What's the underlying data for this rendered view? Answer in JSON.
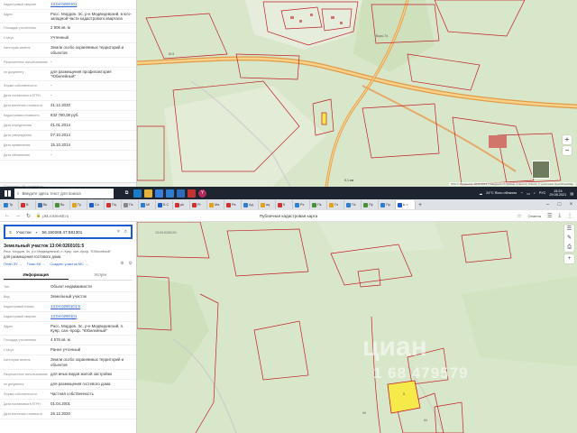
{
  "top_panel": {
    "rows": [
      {
        "key": "Кадастровый квартал",
        "value": "13:04:0260101",
        "link": true
      },
      {
        "key": "Адрес",
        "value": "Росс. Мордов. Эс, р-н Медведевский, в юго-западной части кадастрового квартала",
        "link": false
      },
      {
        "key": "Площадь уточненная",
        "value": "2 906 кв. м",
        "link": false
      },
      {
        "key": "Статус",
        "value": "Учтенный",
        "link": false
      },
      {
        "key": "Категория земель",
        "value": "Земли особо охраняемых территорий и объектов",
        "link": false
      },
      {
        "key": "Разрешенное использование",
        "value": "-",
        "link": false
      },
      {
        "key": "по документу",
        "value": "для размещения профилактория \"Юбилейный\"",
        "link": false
      },
      {
        "key": "Форма собственности",
        "value": "-",
        "link": false
      },
      {
        "key": "Дата постановки в ЕГРН",
        "value": "-",
        "link": false
      },
      {
        "key": "Дата внесения стоимости",
        "value": "31.12.2020",
        "link": false
      },
      {
        "key": "Кадастровая стоимость",
        "value": "832 780,08 руб.",
        "link": false
      },
      {
        "key": "Дата определения",
        "value": "01.01.2014",
        "link": false
      },
      {
        "key": "Дата утверждения",
        "value": "07.10.2014",
        "link": false
      },
      {
        "key": "Дата применения",
        "value": "15.10.2014",
        "link": false
      },
      {
        "key": "Дата обновления",
        "value": "-",
        "link": false
      }
    ],
    "footer": "Соединено pkk.rosreestr.ru"
  },
  "top_map": {
    "road_labels": [
      "М-5",
      "Ворк-74"
    ],
    "scale_label": "0,1 км",
    "attribution": "ПКК © Росреестр, 2010-2021 | Сведения об уровне точности, USGS | © участники OpenStreetMap"
  },
  "taskbar": {
    "search_placeholder": "Введите здесь текст для поиска",
    "weather": "24°C  Ясно облачно",
    "lang": "РУС",
    "time": "15:24",
    "date": "29.06.2021"
  },
  "tabs": [
    {
      "label": "Тр",
      "color": "#2d7dd2"
    },
    {
      "label": "В",
      "color": "#d23030"
    },
    {
      "label": "Вк",
      "color": "#3d6fb6"
    },
    {
      "label": "Вс",
      "color": "#4a8f3a"
    },
    {
      "label": "Гр",
      "color": "#e2a31c"
    },
    {
      "label": "Со",
      "color": "#1a5cd0"
    },
    {
      "label": "Пц",
      "color": "#d23030"
    },
    {
      "label": "Пс",
      "color": "#888888"
    },
    {
      "label": "Mi",
      "color": "#2d7dd2"
    },
    {
      "label": "Б С",
      "color": "#1a5cd0"
    },
    {
      "label": "pk",
      "color": "#d23030"
    },
    {
      "label": "Pr",
      "color": "#d23030"
    },
    {
      "label": "Ма",
      "color": "#e2a31c"
    },
    {
      "label": "Ра",
      "color": "#d23030"
    },
    {
      "label": "Ад",
      "color": "#2d7dd2"
    },
    {
      "label": "яц",
      "color": "#e2a31c"
    },
    {
      "label": "К",
      "color": "#d23030"
    },
    {
      "label": "Рэ",
      "color": "#2d7dd2"
    },
    {
      "label": "Пк",
      "color": "#4a8f3a"
    },
    {
      "label": "Гл",
      "color": "#e2a31c"
    },
    {
      "label": "Пс",
      "color": "#2d7dd2"
    },
    {
      "label": "Пу",
      "color": "#4a8f3a"
    },
    {
      "label": "Пр",
      "color": "#2d7dd2"
    }
  ],
  "active_tab": {
    "label": "Ь",
    "color": "#1a5cd0"
  },
  "toolbar": {
    "url": "pkk.rosreestr.ru",
    "page_title": "Публичная кадастровая карта",
    "right_label": "Отмена"
  },
  "search": {
    "category": "Участки",
    "query": "56.150265 47.581301"
  },
  "parcel": {
    "title": "Земельный участок 13:04:0260101:5",
    "address": "Росс. Мордов. Эс, р-н Медведевский, п. Куяр, сан.-проф. \"Юбилейный\"",
    "purpose": "для размещения гостевого дома",
    "links": [
      "План ЗУ →",
      "План КК →",
      "Создать участок МС →"
    ],
    "tab_info": "Информация",
    "tab_services": "Услуги",
    "rows": [
      {
        "key": "Тип",
        "value": "Объект недвижимости",
        "link": false
      },
      {
        "key": "Вид",
        "value": "Земельный участок",
        "link": false
      },
      {
        "key": "Кадастровый номер",
        "value": "13:04:0260101:5",
        "link": true
      },
      {
        "key": "Кадастровый квартал",
        "value": "13:04:0260101",
        "link": true
      },
      {
        "key": "Адрес",
        "value": "Росс. Мордов. Эс, р-н Медведевский, п. Куяр, сан.-проф. \"Юбилейный\"",
        "link": false
      },
      {
        "key": "Площадь уточненная",
        "value": "4 576 кв. м",
        "link": false
      },
      {
        "key": "Статус",
        "value": "Ранее учтенный",
        "link": false
      },
      {
        "key": "Категория земель",
        "value": "Земли особо охраняемых территорий и объектов",
        "link": false
      },
      {
        "key": "Разрешенное использование",
        "value": "для иных видов жилой застройки",
        "link": false
      },
      {
        "key": "по документу",
        "value": "для размещения гостевого дома",
        "link": false
      },
      {
        "key": "Форма собственности",
        "value": "Частная собственность",
        "link": false
      },
      {
        "key": "Дата постановки в ЕГРН",
        "value": "01.04.2001",
        "link": false
      },
      {
        "key": "Дата внесения стоимости",
        "value": "26.12.2020",
        "link": false
      }
    ]
  },
  "bottom_map": {
    "parcel_label": "5",
    "plot_labels": [
      "13:04:0260101",
      "99",
      "84"
    ],
    "watermark_main": "циан",
    "watermark_sub": "1 68 479579"
  },
  "colors": {
    "map_green": "#d8e7c9",
    "parcel_line": "#c2202a",
    "road_orange": "#e39a47",
    "selected_parcel": "#f6ea4a",
    "search_border": "#1a5cd0"
  }
}
